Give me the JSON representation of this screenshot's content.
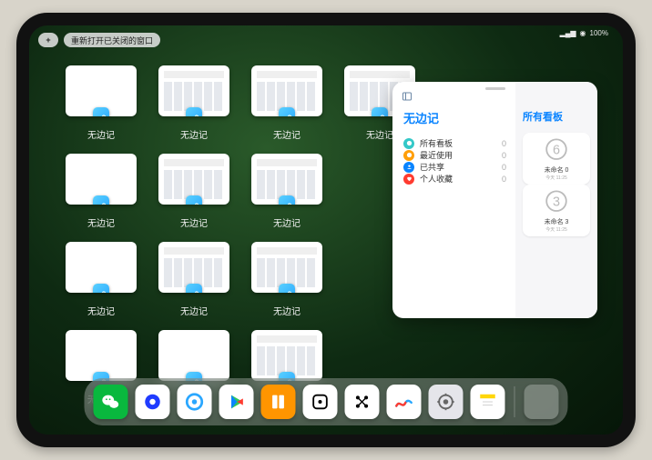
{
  "status": {
    "battery": "100%",
    "wifi": "wifi-icon",
    "signal": "signal-icon"
  },
  "topbar": {
    "plus_label": "+",
    "reopen_label": "重新打开已关闭的窗口"
  },
  "app_windows": {
    "label": "无边记",
    "items": [
      {
        "variant": "blank"
      },
      {
        "variant": "cal"
      },
      {
        "variant": "cal"
      },
      {
        "variant": "cal"
      },
      {
        "variant": "blank"
      },
      {
        "variant": "cal"
      },
      {
        "variant": "cal"
      },
      {
        "variant": null
      },
      {
        "variant": "blank"
      },
      {
        "variant": "cal"
      },
      {
        "variant": "cal"
      },
      {
        "variant": null
      },
      {
        "variant": "blank"
      },
      {
        "variant": "blank"
      },
      {
        "variant": "cal"
      },
      {
        "variant": null
      }
    ]
  },
  "panel": {
    "title": "无边记",
    "right_title": "所有看板",
    "categories": [
      {
        "icon": "cloud",
        "color": "#34c8c8",
        "label": "所有看板",
        "count": 0
      },
      {
        "icon": "clock",
        "color": "#ff9f0a",
        "label": "最近使用",
        "count": 0
      },
      {
        "icon": "people",
        "color": "#0a84ff",
        "label": "已共享",
        "count": 0
      },
      {
        "icon": "heart",
        "color": "#ff3b30",
        "label": "个人收藏",
        "count": 0
      }
    ],
    "boards": [
      {
        "name": "未命名 0",
        "time": "今天 11:25",
        "glyph": "6"
      },
      {
        "name": "未命名 3",
        "time": "今天 11:25",
        "glyph": "3"
      }
    ]
  },
  "dock": {
    "apps": [
      {
        "name": "wechat",
        "bg": "#09b83e"
      },
      {
        "name": "quark",
        "bg": "#ffffff"
      },
      {
        "name": "qqbrowser",
        "bg": "#ffffff"
      },
      {
        "name": "play",
        "bg": "#ffffff"
      },
      {
        "name": "books",
        "bg": "#ff9500"
      },
      {
        "name": "dice",
        "bg": "#ffffff"
      },
      {
        "name": "dots",
        "bg": "#ffffff"
      },
      {
        "name": "freeform",
        "bg": "#ffffff"
      },
      {
        "name": "settings",
        "bg": "#e5e5ea"
      },
      {
        "name": "notes",
        "bg": "#ffffff"
      }
    ]
  }
}
